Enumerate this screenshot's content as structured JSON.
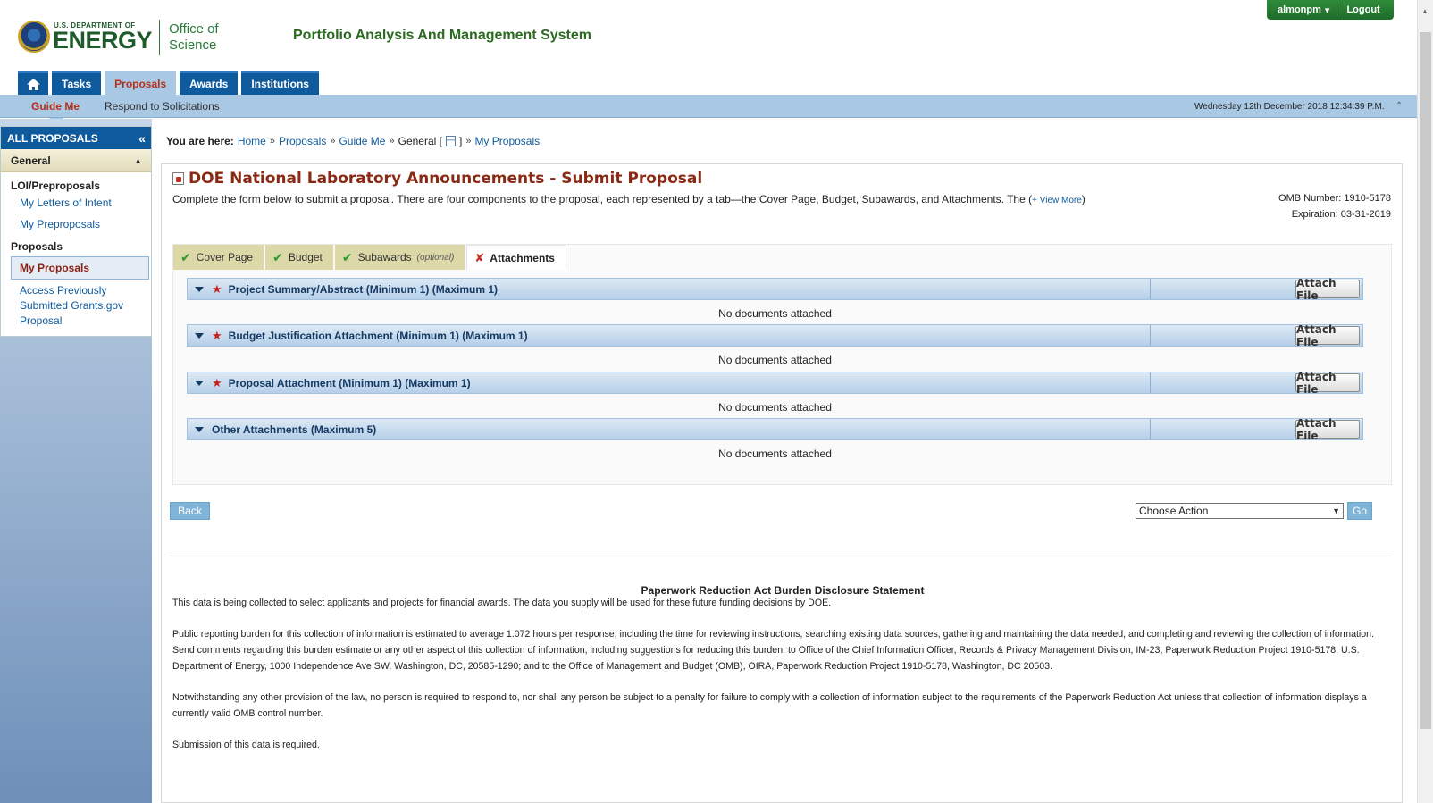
{
  "header": {
    "dept_label": "U.S. DEPARTMENT OF",
    "energy_label": "ENERGY",
    "office_label": "Office of Science",
    "system_title": "Portfolio Analysis And Management System",
    "username": "almonpm",
    "logout_label": "Logout"
  },
  "nav": {
    "items": [
      {
        "label": "Tasks"
      },
      {
        "label": "Proposals"
      },
      {
        "label": "Awards"
      },
      {
        "label": "Institutions"
      }
    ]
  },
  "subnav": {
    "guide_me": "Guide Me",
    "respond": "Respond to Solicitations",
    "date": "Wednesday 12th December 2018 12:34:39 P.M."
  },
  "sidebar": {
    "title": "ALL PROPOSALS",
    "section": "General",
    "groups": [
      {
        "label": "LOI/Preproposals",
        "links": [
          "My Letters of Intent",
          "My Preproposals"
        ]
      },
      {
        "label": "Proposals",
        "links": [
          "My Proposals",
          "Access Previously Submitted Grants.gov Proposal"
        ]
      }
    ]
  },
  "breadcrumb": {
    "label": "You are here:",
    "items": [
      "Home",
      "Proposals",
      "Guide Me",
      "General [",
      "]",
      "My Proposals"
    ]
  },
  "page": {
    "title": "DOE National Laboratory Announcements - Submit Proposal",
    "intro": "Complete the form below to submit a proposal. There are four components to the proposal, each represented by a tab—the Cover Page, Budget, Subawards, and Attachments. The (",
    "view_more": "+ View More",
    "intro_end": ")",
    "omb_number": "OMB Number: 1910-5178",
    "expiration": "Expiration: 03-31-2019"
  },
  "tabs": [
    {
      "label": "Cover Page"
    },
    {
      "label": "Budget"
    },
    {
      "label": "Subawards",
      "suffix": "(optional)"
    },
    {
      "label": "Attachments"
    }
  ],
  "attachments": [
    {
      "title": "Project Summary/Abstract (Minimum 1) (Maximum 1)",
      "required": true
    },
    {
      "title": "Budget Justification Attachment (Minimum 1) (Maximum 1)",
      "required": true
    },
    {
      "title": "Proposal Attachment (Minimum 1) (Maximum 1)",
      "required": true
    },
    {
      "title": "Other Attachments (Maximum 5)",
      "required": false
    }
  ],
  "attach_label": "Attach File",
  "no_docs_label": "No documents attached",
  "actions": {
    "back_label": "Back",
    "select_value": "Choose Action",
    "go_label": "Go"
  },
  "pra": {
    "title": "Paperwork Reduction Act Burden Disclosure Statement",
    "p1": "This data is being collected to select applicants and projects for financial awards. The data you supply will be used for these future funding decisions by DOE.",
    "p2": "Public reporting burden for this collection of information is estimated to average 1.072 hours per response, including the time for reviewing instructions, searching existing data sources, gathering and maintaining the data needed, and completing and reviewing the collection of information. Send comments regarding this burden estimate or any other aspect of this collection of information, including suggestions for reducing this burden, to Office of the Chief Information Officer, Records & Privacy Management Division, IM-23, Paperwork Reduction Project 1910-5178, U.S. Department of Energy, 1000 Independence Ave SW, Washington, DC, 20585-1290; and to the Office of Management and Budget (OMB), OIRA, Paperwork Reduction Project 1910-5178, Washington, DC 20503.",
    "p3": "Notwithstanding any other provision of the law, no person is required to respond to, nor shall any person be subject to a penalty for failure to comply with a collection of information subject to the requirements of the Paperwork Reduction Act unless that collection of information displays a currently valid OMB control number.",
    "p4": "Submission of this data is required."
  },
  "colors": {
    "nav_blue": "#0f5a9c",
    "active_tab_red": "#b3311a",
    "title_brown": "#8a2a14",
    "header_green": "#2a6b1f"
  }
}
